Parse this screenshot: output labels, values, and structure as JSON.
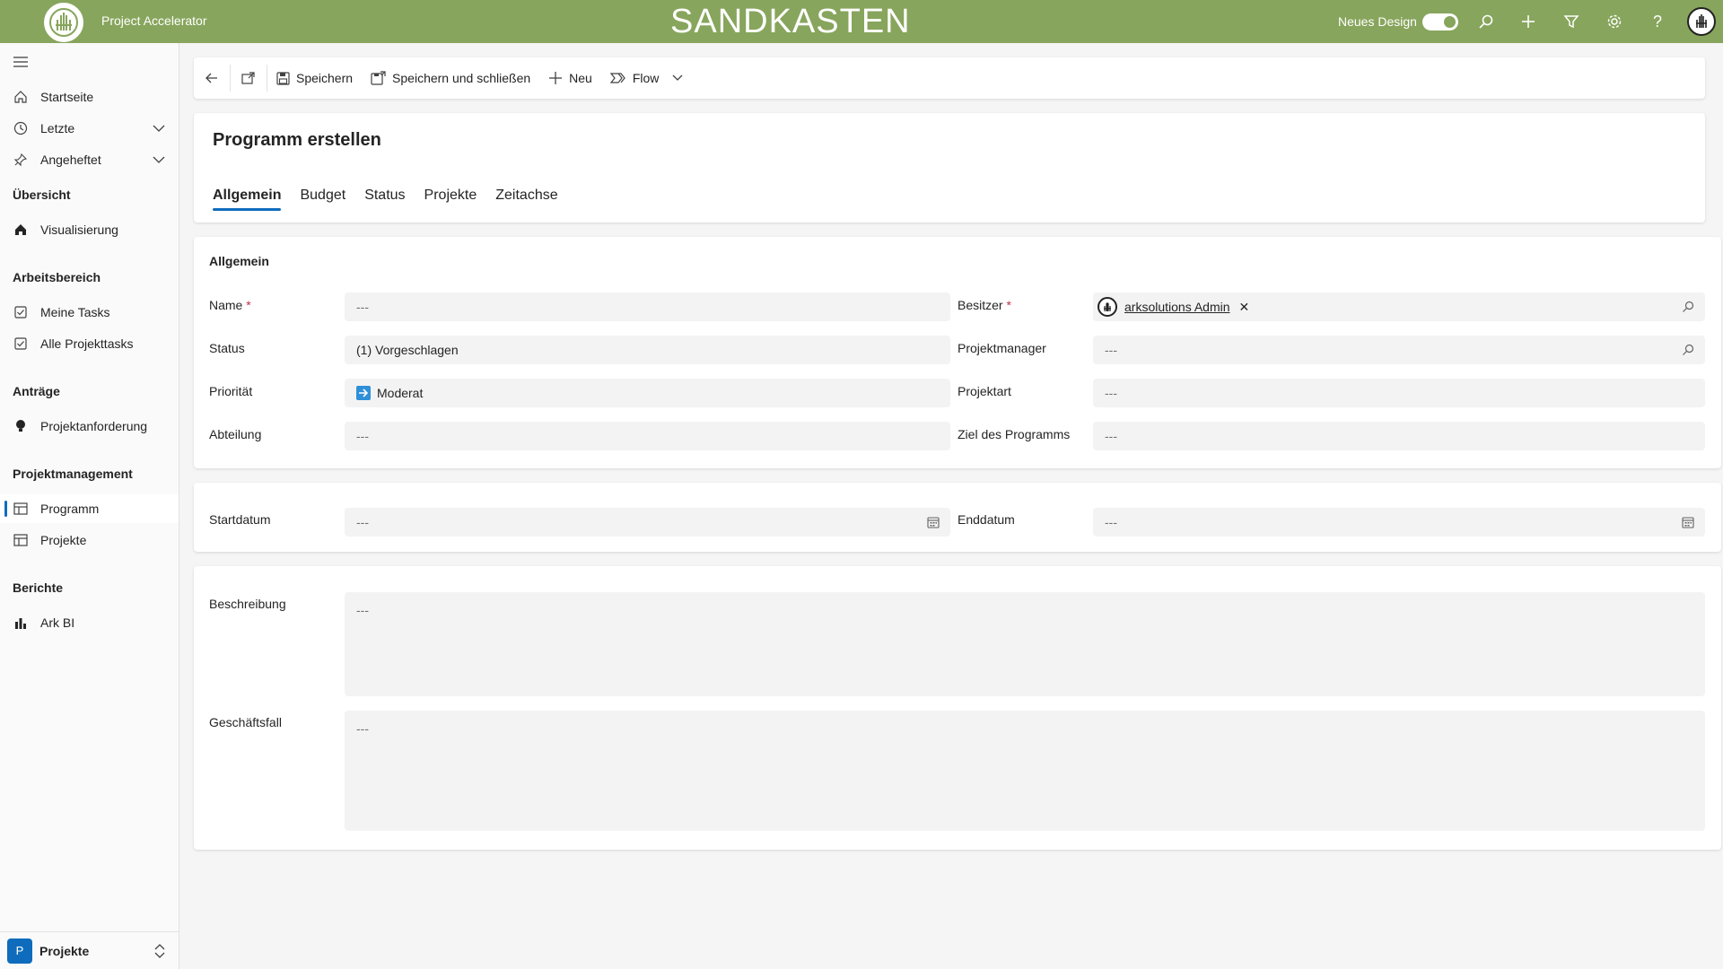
{
  "header": {
    "app_title": "Project Accelerator",
    "env_title": "SANDKASTEN",
    "design_label": "Neues Design",
    "design_toggle_on": true,
    "icons": [
      "search-icon",
      "plus-icon",
      "filter-icon",
      "gear-icon",
      "help-icon",
      "avatar"
    ]
  },
  "sidebar": {
    "top_items": [
      {
        "label": "Startseite",
        "icon": "home-icon"
      },
      {
        "label": "Letzte",
        "icon": "clock-icon"
      },
      {
        "label": "Angeheftet",
        "icon": "pin-icon"
      }
    ],
    "groups": {
      "overview": "Übersicht",
      "workspace": "Arbeitsbereich",
      "requests": "Anträge",
      "pm": "Projektmanagement",
      "reports": "Berichte"
    },
    "items": {
      "visualisierung": "Visualisierung",
      "meine_tasks": "Meine Tasks",
      "alle_projekttasks": "Alle Projekttasks",
      "projektanforderung": "Projektanforderung",
      "programm": "Programm",
      "projekte": "Projekte",
      "ark_bi": "Ark BI"
    },
    "area_badge": "P",
    "area_label": "Projekte"
  },
  "commands": {
    "save": "Speichern",
    "save_close": "Speichern und schließen",
    "new": "Neu",
    "flow": "Flow"
  },
  "page": {
    "title": "Programm erstellen",
    "tabs": [
      "Allgemein",
      "Budget",
      "Status",
      "Projekte",
      "Zeitachse"
    ],
    "active_tab": "Allgemein"
  },
  "form": {
    "section_title": "Allgemein",
    "empty": "---",
    "name_label": "Name",
    "status_label": "Status",
    "status_value": "(1) Vorgeschlagen",
    "priority_label": "Priorität",
    "priority_value": "Moderat",
    "department_label": "Abteilung",
    "owner_label": "Besitzer",
    "owner_value": "arksolutions Admin",
    "pm_label": "Projektmanager",
    "type_label": "Projektart",
    "goal_label": "Ziel des Programms",
    "start_label": "Startdatum",
    "end_label": "Enddatum",
    "description_label": "Beschreibung",
    "business_case_label": "Geschäftsfall",
    "required_mark": "*"
  },
  "colors": {
    "header_bg": "#87a55c",
    "accent": "#0f6cbd",
    "required": "#c4314b"
  }
}
